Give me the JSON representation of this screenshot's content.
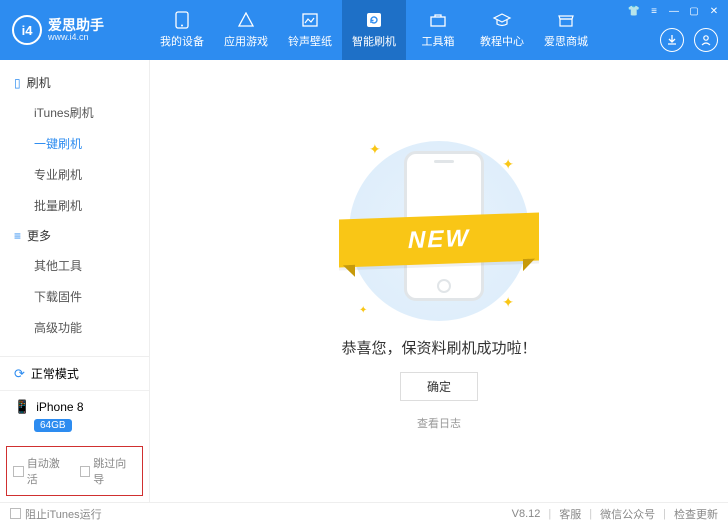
{
  "app": {
    "name": "爱思助手",
    "site": "www.i4.cn",
    "logo_text": "i4"
  },
  "nav": {
    "items": [
      {
        "label": "我的设备"
      },
      {
        "label": "应用游戏"
      },
      {
        "label": "铃声壁纸"
      },
      {
        "label": "智能刷机"
      },
      {
        "label": "工具箱"
      },
      {
        "label": "教程中心"
      },
      {
        "label": "爱思商城"
      }
    ]
  },
  "sidebar": {
    "section1": {
      "title": "刷机",
      "items": [
        "iTunes刷机",
        "一键刷机",
        "专业刷机",
        "批量刷机"
      ]
    },
    "section2": {
      "title": "更多",
      "items": [
        "其他工具",
        "下载固件",
        "高级功能"
      ]
    },
    "status": "正常模式",
    "device": {
      "name": "iPhone 8",
      "storage": "64GB"
    },
    "checks": {
      "auto_activate": "自动激活",
      "skip_guide": "跳过向导"
    }
  },
  "content": {
    "ribbon": "NEW",
    "message": "恭喜您，保资料刷机成功啦！",
    "ok": "确定",
    "view_log": "查看日志"
  },
  "footer": {
    "block_itunes": "阻止iTunes运行",
    "version": "V8.12",
    "support": "客服",
    "wechat": "微信公众号",
    "update": "检查更新"
  }
}
